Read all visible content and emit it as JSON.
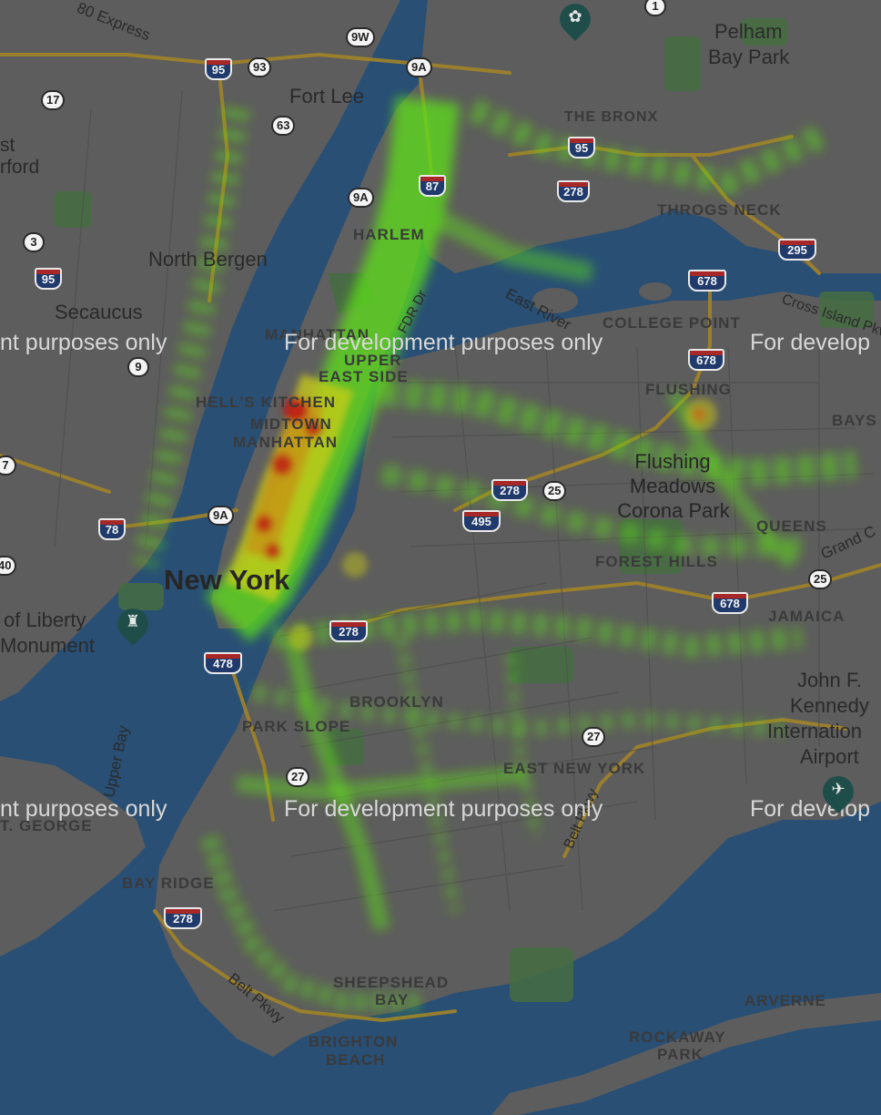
{
  "map": {
    "colors": {
      "water": "#2f5a86",
      "land": "#6a6a6a",
      "park": "#4f7d4a",
      "highway": "#b8962e",
      "heat_low": "#6aff1a",
      "heat_mid": "#e8e81a",
      "heat_high": "#d81616"
    },
    "labels": {
      "express": "80 Express",
      "pelham": "Pelham",
      "bay_park": "Bay Park",
      "fort_lee": "Fort Lee",
      "the_bronx": "THE BRONX",
      "east_rutherford_a": "st",
      "east_rutherford_b": "rford",
      "throgs_neck": "THROGS NECK",
      "harlem": "HARLEM",
      "north_bergen": "North Bergen",
      "secaucus": "Secaucus",
      "east_river": "East River",
      "fdr": "FDR Dr",
      "manhattan": "MANHATTAN",
      "college_point": "COLLEGE POINT",
      "cross_island": "Cross Island Pkwy",
      "upper_east": "UPPER",
      "upper_east_b": "EAST SIDE",
      "hells_kitchen": "HELL'S KITCHEN",
      "flushing": "FLUSHING",
      "bayside": "BAYS",
      "midtown": "MIDTOWN",
      "midtown_b": "MANHATTAN",
      "flushing_meadows_a": "Flushing",
      "flushing_meadows_b": "Meadows",
      "flushing_meadows_c": "Corona Park",
      "queens": "QUEENS",
      "grand_central": "Grand C",
      "forest_hills": "FOREST HILLS",
      "new_york": "New York",
      "jamaica": "JAMAICA",
      "statue_a": "of Liberty",
      "statue_b": "Monument",
      "jfk_a": "John F.",
      "jfk_b": "Kennedy",
      "jfk_c": "Internation",
      "jfk_d": "Airport",
      "brooklyn": "BROOKLYN",
      "park_slope": "PARK SLOPE",
      "upper_bay": "Upper Bay",
      "east_new_york": "EAST NEW YORK",
      "belt_pkwy_east": "Belt Pkwy",
      "st_george": "T. GEORGE",
      "bay_ridge": "BAY RIDGE",
      "belt_pkwy_south": "Belt Pkwy",
      "sheepshead_a": "SHEEPSHEAD",
      "sheepshead_b": "BAY",
      "arverne": "ARVERNE",
      "brighton_a": "BRIGHTON",
      "brighton_b": "BEACH",
      "rockaway_a": "ROCKAWAY",
      "rockaway_b": "PARK"
    },
    "watermark": {
      "left": "nt purposes only",
      "center": "For development purposes only",
      "right": "For develop"
    },
    "interstate_shields": [
      "95",
      "87",
      "95",
      "278",
      "295",
      "678",
      "95",
      "678",
      "278",
      "495",
      "678",
      "78",
      "278",
      "478",
      "278"
    ],
    "route_ovals": [
      "1",
      "9W",
      "93",
      "9A",
      "17",
      "63",
      "9A",
      "3",
      "9",
      "7",
      "25",
      "9A",
      "25",
      "27",
      "27",
      "40"
    ],
    "icons": [
      "garden-pin-icon",
      "monument-pin-icon",
      "airport-pin-icon"
    ]
  }
}
